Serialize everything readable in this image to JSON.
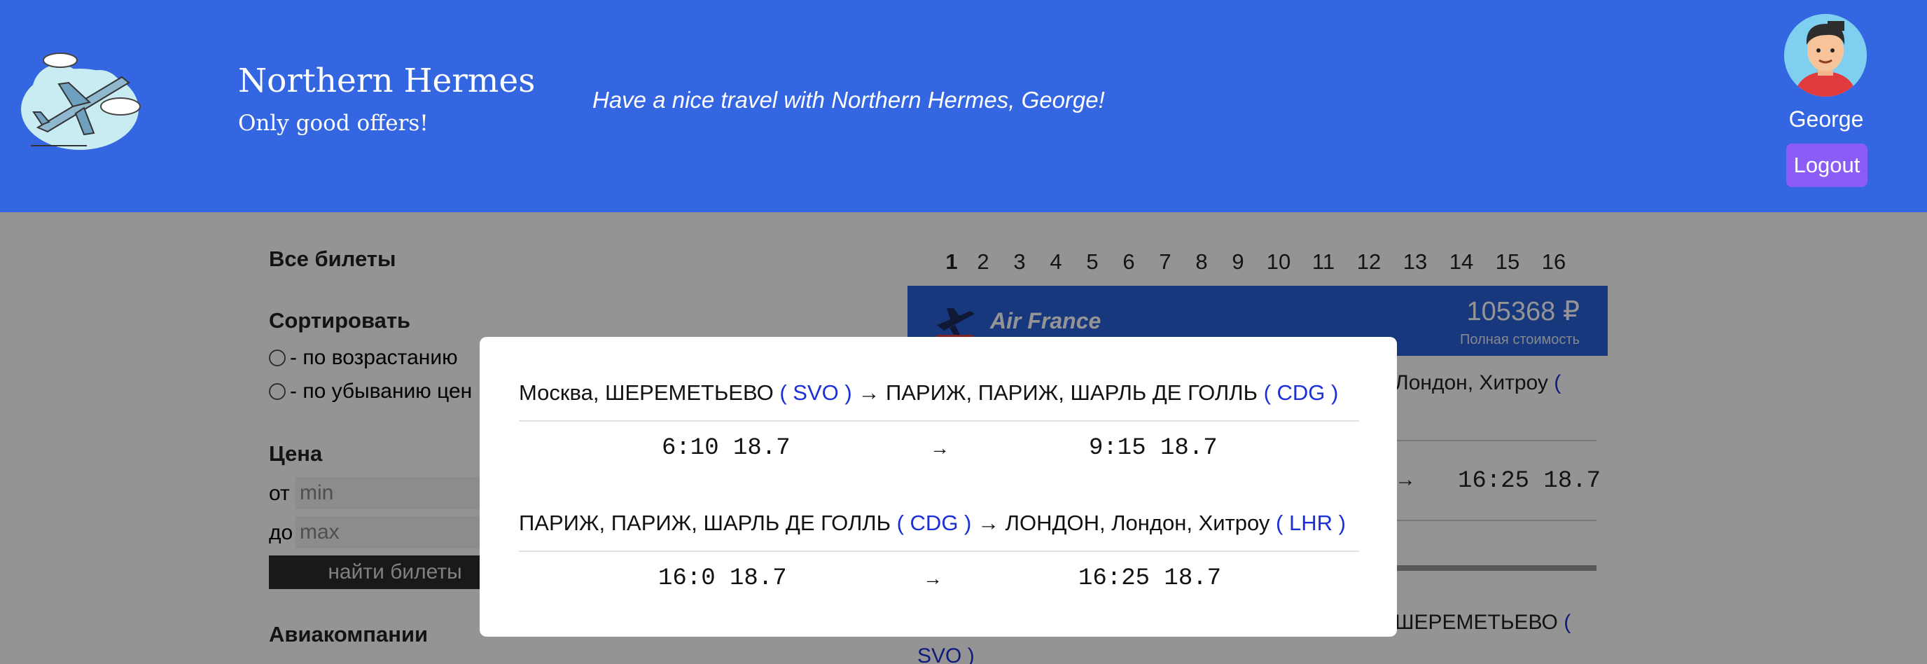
{
  "header": {
    "title": "Northern Hermes",
    "subtitle": "Only good offers!",
    "greeting": "Have a nice travel with Northern Hermes, George!",
    "user_name": "George",
    "logout_label": "Logout"
  },
  "sidebar": {
    "all_tickets": "Все билеты",
    "sort_title": "Сортировать",
    "sort_asc": "- по возрастанию",
    "sort_desc": "- по убыванию цен",
    "price_title": "Цена",
    "from_label": "от",
    "from_placeholder": "min",
    "to_label": "до",
    "to_placeholder": "max",
    "find_button": "найти билеты",
    "airlines_title": "Авиакомпании"
  },
  "pagination": [
    "1",
    "2",
    "3",
    "4",
    "5",
    "6",
    "7",
    "8",
    "9",
    "10",
    "11",
    "12",
    "13",
    "14",
    "15",
    "16"
  ],
  "pagination_current": "1",
  "ticket": {
    "airline": "Air France",
    "price": "105368 ₽",
    "price_caption": "Полная стоимость",
    "partial_route_1": "Лондон, Хитроу",
    "partial_route_1_code": "(",
    "partial_time_arrow": "→",
    "partial_time": "16:25 18.7",
    "partial_route_2": "ШЕРЕМЕТЬЕВО",
    "partial_route_2_code_open": "(",
    "partial_route_2_code": "SVO )"
  },
  "modal": {
    "segments": [
      {
        "from": "Москва, ШЕРЕМЕТЬЕВО",
        "from_code": "( SVO )",
        "arrow": "→",
        "to": "ПАРИЖ, ПАРИЖ, ШАРЛЬ ДЕ ГОЛЛЬ",
        "to_code": "( CDG )",
        "depart": "6:10 18.7",
        "time_arrow": "→",
        "arrive": "9:15 18.7"
      },
      {
        "from": "ПАРИЖ, ПАРИЖ, ШАРЛЬ ДЕ ГОЛЛЬ",
        "from_code": "( CDG )",
        "arrow": "→",
        "to": "ЛОНДОН, Лондон, Хитроу",
        "to_code": "( LHR )",
        "depart": "16:0 18.7",
        "time_arrow": "→",
        "arrive": "16:25 18.7"
      }
    ]
  },
  "colors": {
    "header_bg": "#3366e0",
    "logout_bg": "#8b5cf6",
    "code_blue": "#1b2fd6"
  },
  "icons": {
    "logo": "airplane-cloud-icon",
    "avatar": "user-avatar",
    "airline_logo": "airplane-icon"
  }
}
